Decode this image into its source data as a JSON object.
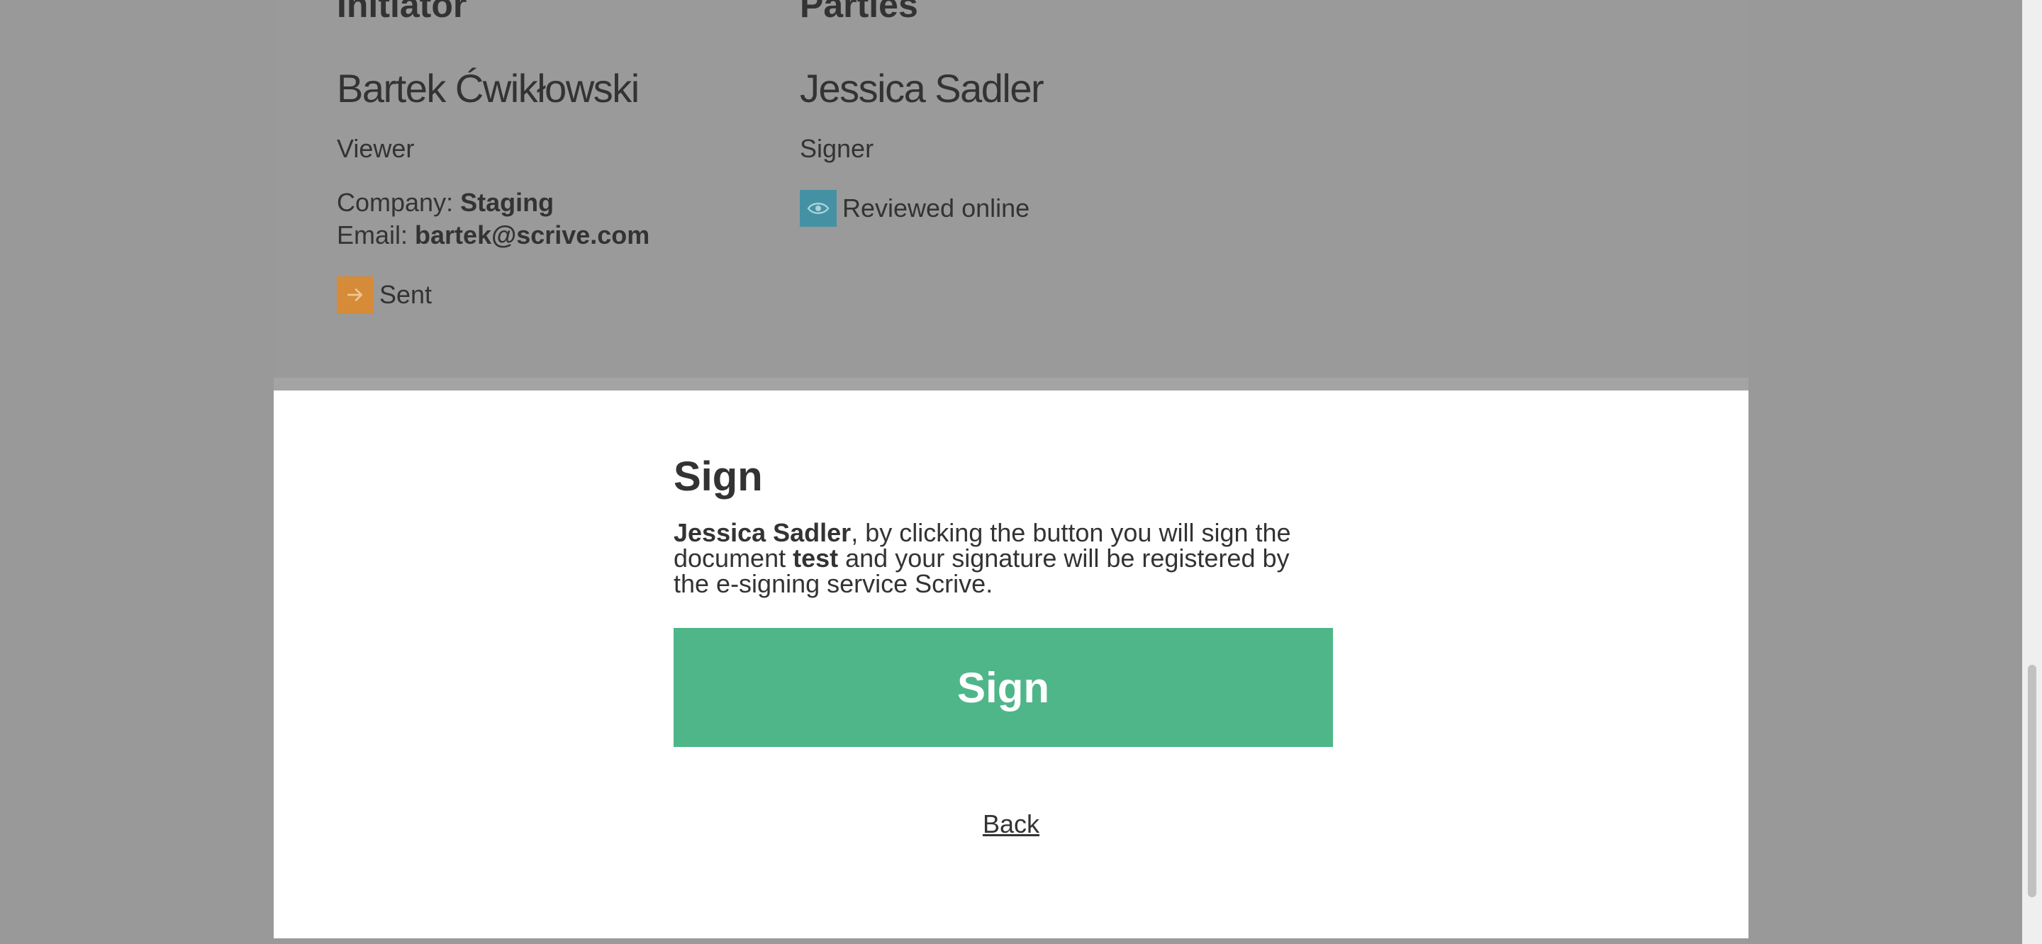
{
  "initiator": {
    "heading": "Initiator",
    "name": "Bartek Ćwikłowski",
    "role": "Viewer",
    "company_label": "Company: ",
    "company": "Staging",
    "email_label": "Email: ",
    "email": "bartek@scrive.com",
    "status_icon": "arrow-right-icon",
    "status_color": "#d58b38",
    "status": "Sent"
  },
  "parties": {
    "heading": "Parties",
    "name": "Jessica Sadler",
    "role": "Signer",
    "status_icon": "eye-icon",
    "status_color": "#4391a3",
    "status": "Reviewed online"
  },
  "sign": {
    "title": "Sign",
    "signer_name": "Jessica Sadler",
    "text_part1": ", by clicking the button you will sign the document ",
    "document_name": "test",
    "text_part2": " and your signature will be registered by the e-signing service Scrive.",
    "button_label": "Sign",
    "button_color": "#4fb689",
    "back_label": "Back"
  }
}
